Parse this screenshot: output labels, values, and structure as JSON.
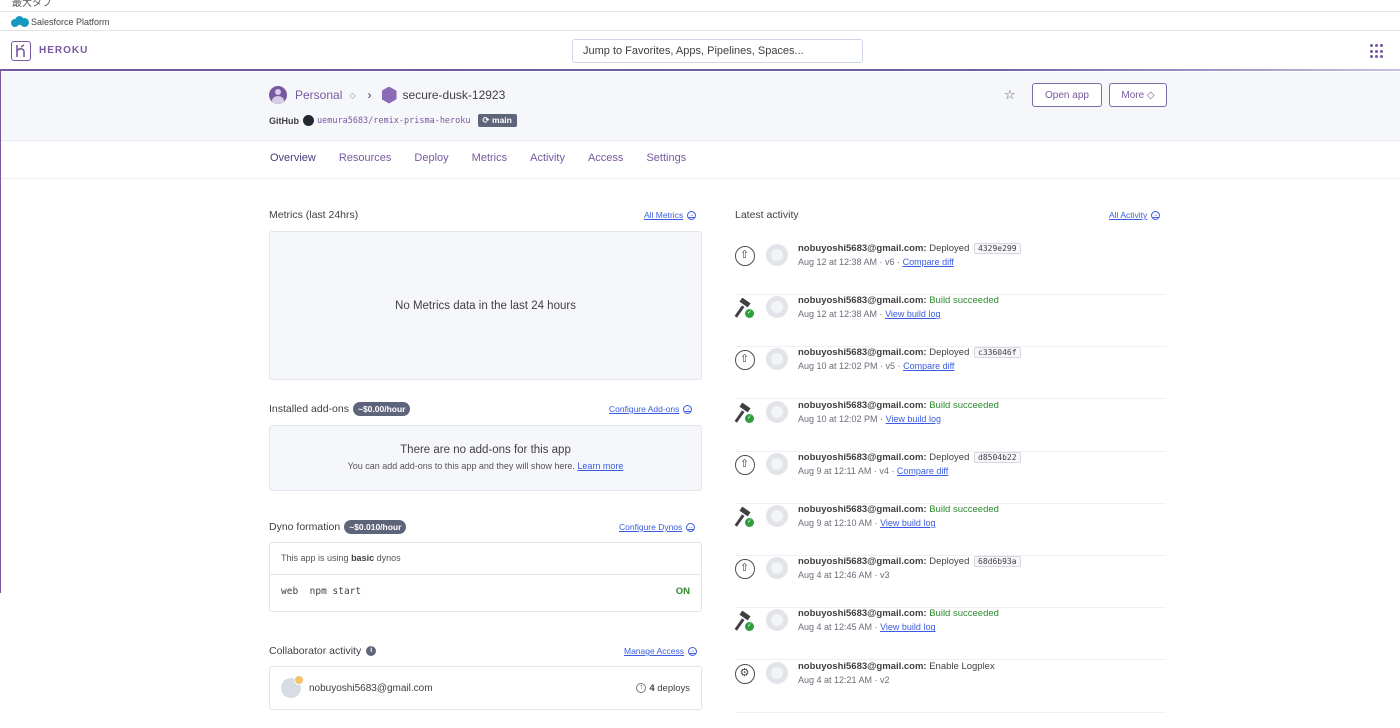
{
  "topstrip": {
    "partial_text": "最大タブ"
  },
  "sfbar": {
    "label": "Salesforce Platform"
  },
  "header": {
    "brand": "HEROKU",
    "search_placeholder": "Jump to Favorites, Apps, Pipelines, Spaces..."
  },
  "app": {
    "account": "Personal",
    "name": "secure-dusk-12923",
    "github_label": "GitHub",
    "repo": "uemura5683/remix-prisma-heroku",
    "branch": "main",
    "open_app": "Open app",
    "more": "More"
  },
  "tabs": [
    "Overview",
    "Resources",
    "Deploy",
    "Metrics",
    "Activity",
    "Access",
    "Settings"
  ],
  "metrics": {
    "title": "Metrics (last 24hrs)",
    "link": "All Metrics",
    "empty": "No Metrics data in the last 24 hours"
  },
  "addons": {
    "title": "Installed add-ons",
    "cost": "~$0.00/hour",
    "link": "Configure Add-ons",
    "empty_title": "There are no add-ons for this app",
    "empty_sub": "You can add add-ons to this app and they will show here.",
    "learn_more": "Learn more"
  },
  "dynos": {
    "title": "Dyno formation",
    "cost": "~$0.010/hour",
    "link": "Configure Dynos",
    "note_prefix": "This app is using",
    "note_type": "basic",
    "note_suffix": "dynos",
    "process": "web",
    "command": "npm start",
    "state": "ON"
  },
  "collaborators": {
    "title": "Collaborator activity",
    "link": "Manage Access",
    "email": "nobuyoshi5683@gmail.com",
    "deploys": "4",
    "deploys_label": "deploys"
  },
  "activity": {
    "title": "Latest activity",
    "link": "All Activity",
    "items": [
      {
        "kind": "deploy",
        "user": "nobuyoshi5683@gmail.com:",
        "action": "Deployed",
        "commit": "4329e299",
        "time": "Aug 12 at 12:38 AM · v6 ·",
        "link": "Compare diff"
      },
      {
        "kind": "build",
        "user": "nobuyoshi5683@gmail.com:",
        "action": "Build succeeded",
        "commit": "",
        "time": "Aug 12 at 12:38 AM ·",
        "link": "View build log"
      },
      {
        "kind": "deploy",
        "user": "nobuyoshi5683@gmail.com:",
        "action": "Deployed",
        "commit": "c336046f",
        "time": "Aug 10 at 12:02 PM · v5 ·",
        "link": "Compare diff"
      },
      {
        "kind": "build",
        "user": "nobuyoshi5683@gmail.com:",
        "action": "Build succeeded",
        "commit": "",
        "time": "Aug 10 at 12:02 PM ·",
        "link": "View build log"
      },
      {
        "kind": "deploy",
        "user": "nobuyoshi5683@gmail.com:",
        "action": "Deployed",
        "commit": "d8504b22",
        "time": "Aug 9 at 12:11 AM · v4 ·",
        "link": "Compare diff"
      },
      {
        "kind": "build",
        "user": "nobuyoshi5683@gmail.com:",
        "action": "Build succeeded",
        "commit": "",
        "time": "Aug 9 at 12:10 AM ·",
        "link": "View build log"
      },
      {
        "kind": "deploy",
        "user": "nobuyoshi5683@gmail.com:",
        "action": "Deployed",
        "commit": "68d6b93a",
        "time": "Aug 4 at 12:46 AM · v3",
        "link": ""
      },
      {
        "kind": "build",
        "user": "nobuyoshi5683@gmail.com:",
        "action": "Build succeeded",
        "commit": "",
        "time": "Aug 4 at 12:45 AM ·",
        "link": "View build log"
      },
      {
        "kind": "addon",
        "user": "nobuyoshi5683@gmail.com:",
        "action": "Enable Logplex",
        "commit": "",
        "time": "Aug 4 at 12:21 AM · v2",
        "link": ""
      }
    ]
  }
}
